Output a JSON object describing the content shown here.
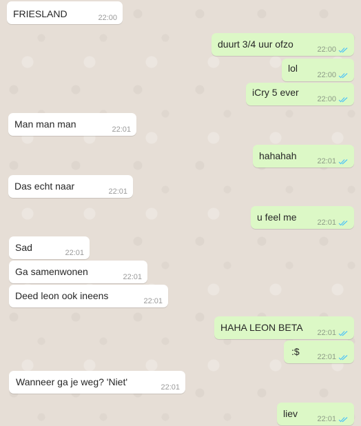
{
  "colors": {
    "background": "#e5ddd5",
    "incoming_bubble": "#ffffff",
    "outgoing_bubble": "#dcf8c6",
    "read_ticks": "#4fc3f7"
  },
  "icons": {
    "read_receipt": "double-check-icon"
  },
  "messages": [
    {
      "direction": "in",
      "text": "FRIESLAND",
      "time": "22:00"
    },
    {
      "direction": "out",
      "text": "duurt 3/4 uur ofzo",
      "time": "22:00"
    },
    {
      "direction": "out",
      "text": "lol",
      "time": "22:00"
    },
    {
      "direction": "out",
      "text": "iCry 5 ever",
      "time": "22:00"
    },
    {
      "direction": "in",
      "text": "Man man man",
      "time": "22:01"
    },
    {
      "direction": "out",
      "text": "hahahah",
      "time": "22:01"
    },
    {
      "direction": "in",
      "text": "Das echt naar",
      "time": "22:01"
    },
    {
      "direction": "out",
      "text": "u feel me",
      "time": "22:01"
    },
    {
      "direction": "in",
      "text": "Sad",
      "time": "22:01"
    },
    {
      "direction": "in",
      "text": "Ga samenwonen",
      "time": "22:01"
    },
    {
      "direction": "in",
      "text": "Deed leon ook ineens",
      "time": "22:01"
    },
    {
      "direction": "out",
      "text": "HAHA LEON BETA",
      "time": "22:01"
    },
    {
      "direction": "out",
      "text": ":$",
      "time": "22:01"
    },
    {
      "direction": "in",
      "text": "Wanneer ga je weg? 'Niet'",
      "time": "22:01"
    },
    {
      "direction": "out",
      "text": "liev",
      "time": "22:01"
    }
  ]
}
